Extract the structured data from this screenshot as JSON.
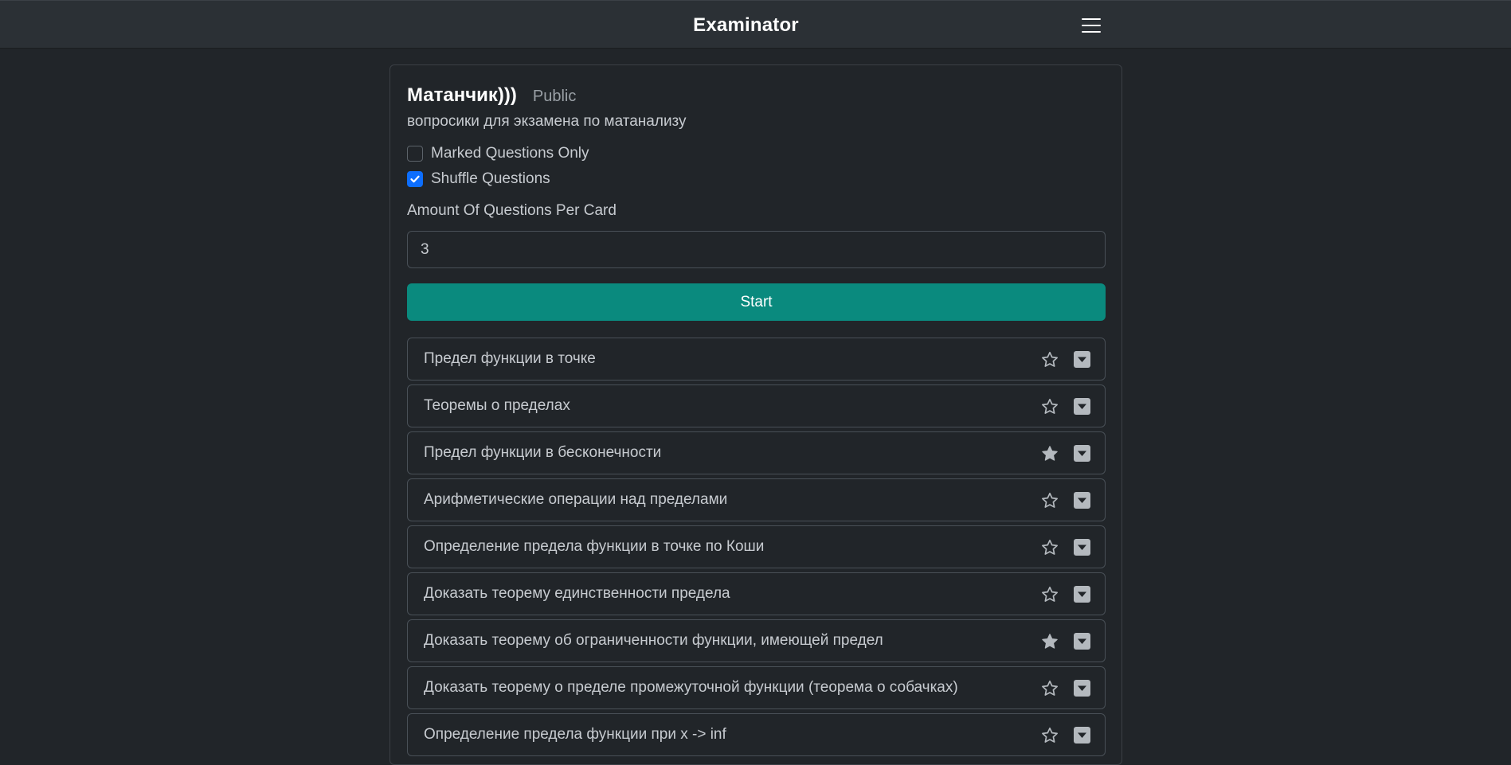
{
  "app": {
    "title": "Examinator"
  },
  "deck": {
    "title": "Матанчик)))",
    "visibility": "Public",
    "description": "вопросики для экзамена по матанализу"
  },
  "options": {
    "marked_only": {
      "label": "Marked Questions Only",
      "checked": false
    },
    "shuffle": {
      "label": "Shuffle Questions",
      "checked": true
    }
  },
  "amount": {
    "label": "Amount Of Questions Per Card",
    "value": "3"
  },
  "start_label": "Start",
  "questions": [
    {
      "text": "Предел функции в точке",
      "starred": false
    },
    {
      "text": "Теоремы о пределах",
      "starred": false
    },
    {
      "text": "Предел функции в бесконечности",
      "starred": true
    },
    {
      "text": "Арифметические операции над пределами",
      "starred": false
    },
    {
      "text": "Определение предела функции в точке по Коши",
      "starred": false
    },
    {
      "text": "Доказать теорему единственности предела",
      "starred": false
    },
    {
      "text": "Доказать теорему об ограниченности функции, имеющей предел",
      "starred": true
    },
    {
      "text": "Доказать теорему о пределе промежуточной функции (теорема о собачках)",
      "starred": false
    },
    {
      "text": "Определение предела функции при x -> inf",
      "starred": false
    }
  ],
  "colors": {
    "background": "#212529",
    "navbar": "#2b3035",
    "start_button": "#0a8a7e",
    "checkbox_checked": "#0d6efd",
    "star_filled": "#b4b9be"
  },
  "icons": {
    "menu": "hamburger-icon",
    "star_empty": "star-outline-icon",
    "star_filled": "star-filled-icon",
    "toggle": "caret-down-square-icon",
    "checkmark": "check-icon"
  }
}
